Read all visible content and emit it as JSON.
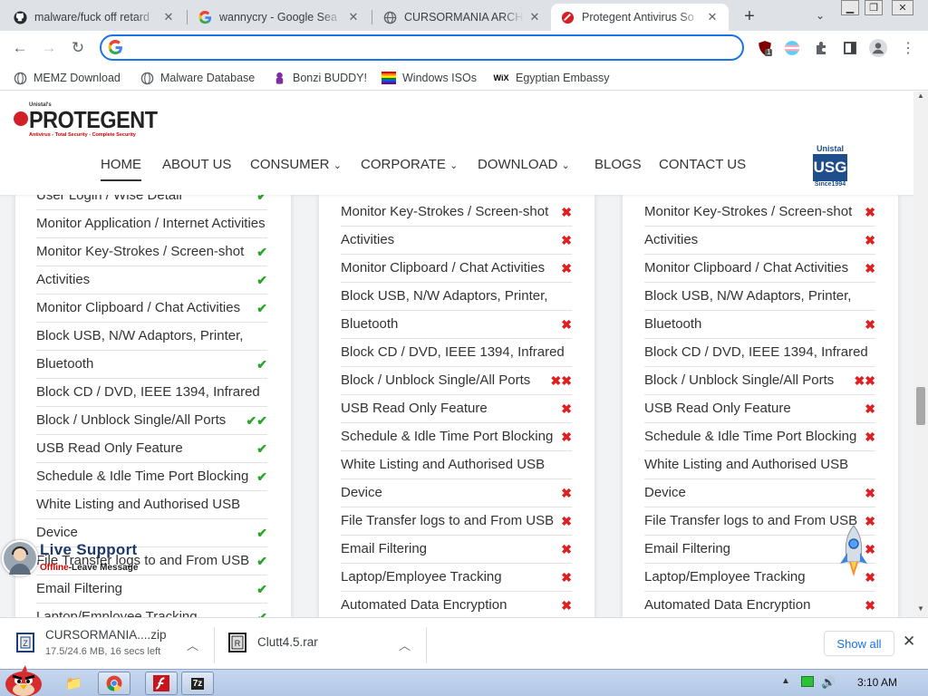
{
  "browser": {
    "tabs": [
      {
        "title": "malware/fuck off retard",
        "favicon": "github-icon",
        "active": false
      },
      {
        "title": "wannycry - Google Sea",
        "favicon": "google-icon",
        "active": false
      },
      {
        "title": "CURSORMANIA ARCHI",
        "favicon": "globe-icon",
        "active": false
      },
      {
        "title": "Protegent Antivirus So",
        "favicon": "protegent-icon",
        "active": true
      }
    ],
    "new_tab": "+",
    "address": {
      "value": "",
      "placeholder": ""
    },
    "extension_badge": "1",
    "bookmarks": [
      {
        "label": "MEMZ Download",
        "icon": "globe-icon"
      },
      {
        "label": "Malware Database",
        "icon": "globe-icon"
      },
      {
        "label": "Bonzi BUDDY!",
        "icon": "bonzi-icon"
      },
      {
        "label": "Windows ISOs",
        "icon": "windows-icon"
      },
      {
        "label": "Egyptian Embassy",
        "icon": "wix-icon"
      }
    ]
  },
  "site": {
    "logo": {
      "brand": "PROTEGENT",
      "small": "Unistal's",
      "tagline": "Antivirus - Total Security - Complete Security"
    },
    "menu": [
      "HOME",
      "ABOUT US",
      "CONSUMER",
      "CORPORATE",
      "DOWNLOAD",
      "BLOGS",
      "CONTACT US"
    ],
    "dropdown_chevron": "⌄",
    "partner_logo": {
      "top": "Unistal",
      "letters": "USG",
      "bottom": "Since1994"
    }
  },
  "columns": {
    "col1": [
      {
        "text": "User Login / Wise Detail",
        "mark": "✔"
      },
      {
        "text": "Monitor Application / Internet Activities",
        "mark": ""
      },
      {
        "text": "Monitor Key-Strokes / Screen-shot",
        "mark": "✔"
      },
      {
        "text": "Activities",
        "mark": "✔"
      },
      {
        "text": "Monitor Clipboard / Chat Activities",
        "mark": "✔"
      },
      {
        "text": "Block USB, N/W Adaptors, Printer,",
        "mark": ""
      },
      {
        "text": "Bluetooth",
        "mark": "✔"
      },
      {
        "text": "Block CD / DVD, IEEE 1394, Infrared",
        "mark": ""
      },
      {
        "text": "Block / Unblock Single/All Ports",
        "mark": "✔✔"
      },
      {
        "text": "USB Read Only Feature",
        "mark": "✔"
      },
      {
        "text": "Schedule & Idle Time Port Blocking",
        "mark": "✔"
      },
      {
        "text": "White Listing and Authorised USB",
        "mark": ""
      },
      {
        "text": "Device",
        "mark": "✔"
      },
      {
        "text": "File Transfer logs to and From USB",
        "mark": "✔"
      },
      {
        "text": "Email Filtering",
        "mark": "✔"
      },
      {
        "text": "Laptop/Employee Tracking",
        "mark": "✔"
      }
    ],
    "col2": [
      {
        "text": "Monitor Key-Strokes / Screen-shot",
        "mark": "✖"
      },
      {
        "text": "Activities",
        "mark": "✖"
      },
      {
        "text": "Monitor Clipboard / Chat Activities",
        "mark": "✖"
      },
      {
        "text": "Block USB, N/W Adaptors, Printer,",
        "mark": ""
      },
      {
        "text": "Bluetooth",
        "mark": "✖"
      },
      {
        "text": "Block CD / DVD, IEEE 1394, Infrared",
        "mark": ""
      },
      {
        "text": "Block / Unblock Single/All Ports",
        "mark": "✖✖"
      },
      {
        "text": "USB Read Only Feature",
        "mark": "✖"
      },
      {
        "text": "Schedule & Idle Time Port Blocking",
        "mark": "✖"
      },
      {
        "text": "White Listing and Authorised USB",
        "mark": ""
      },
      {
        "text": "Device",
        "mark": "✖"
      },
      {
        "text": "File Transfer logs to and From USB",
        "mark": "✖"
      },
      {
        "text": "Email Filtering",
        "mark": "✖"
      },
      {
        "text": "Laptop/Employee Tracking",
        "mark": "✖"
      },
      {
        "text": "Automated Data Encryption",
        "mark": "✖"
      }
    ],
    "col3": [
      {
        "text": "Monitor Key-Strokes / Screen-shot",
        "mark": "✖"
      },
      {
        "text": "Activities",
        "mark": "✖"
      },
      {
        "text": "Monitor Clipboard / Chat Activities",
        "mark": "✖"
      },
      {
        "text": "Block USB, N/W Adaptors, Printer,",
        "mark": ""
      },
      {
        "text": "Bluetooth",
        "mark": "✖"
      },
      {
        "text": "Block CD / DVD, IEEE 1394, Infrared",
        "mark": ""
      },
      {
        "text": "Block / Unblock Single/All Ports",
        "mark": "✖✖"
      },
      {
        "text": "USB Read Only Feature",
        "mark": "✖"
      },
      {
        "text": "Schedule & Idle Time Port Blocking",
        "mark": "✖"
      },
      {
        "text": "White Listing and Authorised USB",
        "mark": ""
      },
      {
        "text": "Device",
        "mark": "✖"
      },
      {
        "text": "File Transfer logs to and From USB",
        "mark": "✖"
      },
      {
        "text": "Email Filtering",
        "mark": "✖"
      },
      {
        "text": "Laptop/Employee Tracking",
        "mark": "✖"
      },
      {
        "text": "Automated Data Encryption",
        "mark": "✖"
      }
    ]
  },
  "live_support": {
    "title": "Live Support",
    "status": "Offline",
    "action": "-Leave Message"
  },
  "downloads": [
    {
      "name": "CURSORMANIA....zip",
      "status": "17.5/24.6 MB, 16 secs left",
      "icon": "zip-file-icon"
    },
    {
      "name": "Clutt4.5.rar",
      "status": "",
      "icon": "rar-file-icon"
    }
  ],
  "downloads_show_all": "Show all",
  "taskbar": {
    "clock": "3:10 AM"
  },
  "colors": {
    "check": "#2aa52a",
    "cross": "#e02020",
    "accent": "#1a73e8",
    "brand_red": "#d32027"
  }
}
